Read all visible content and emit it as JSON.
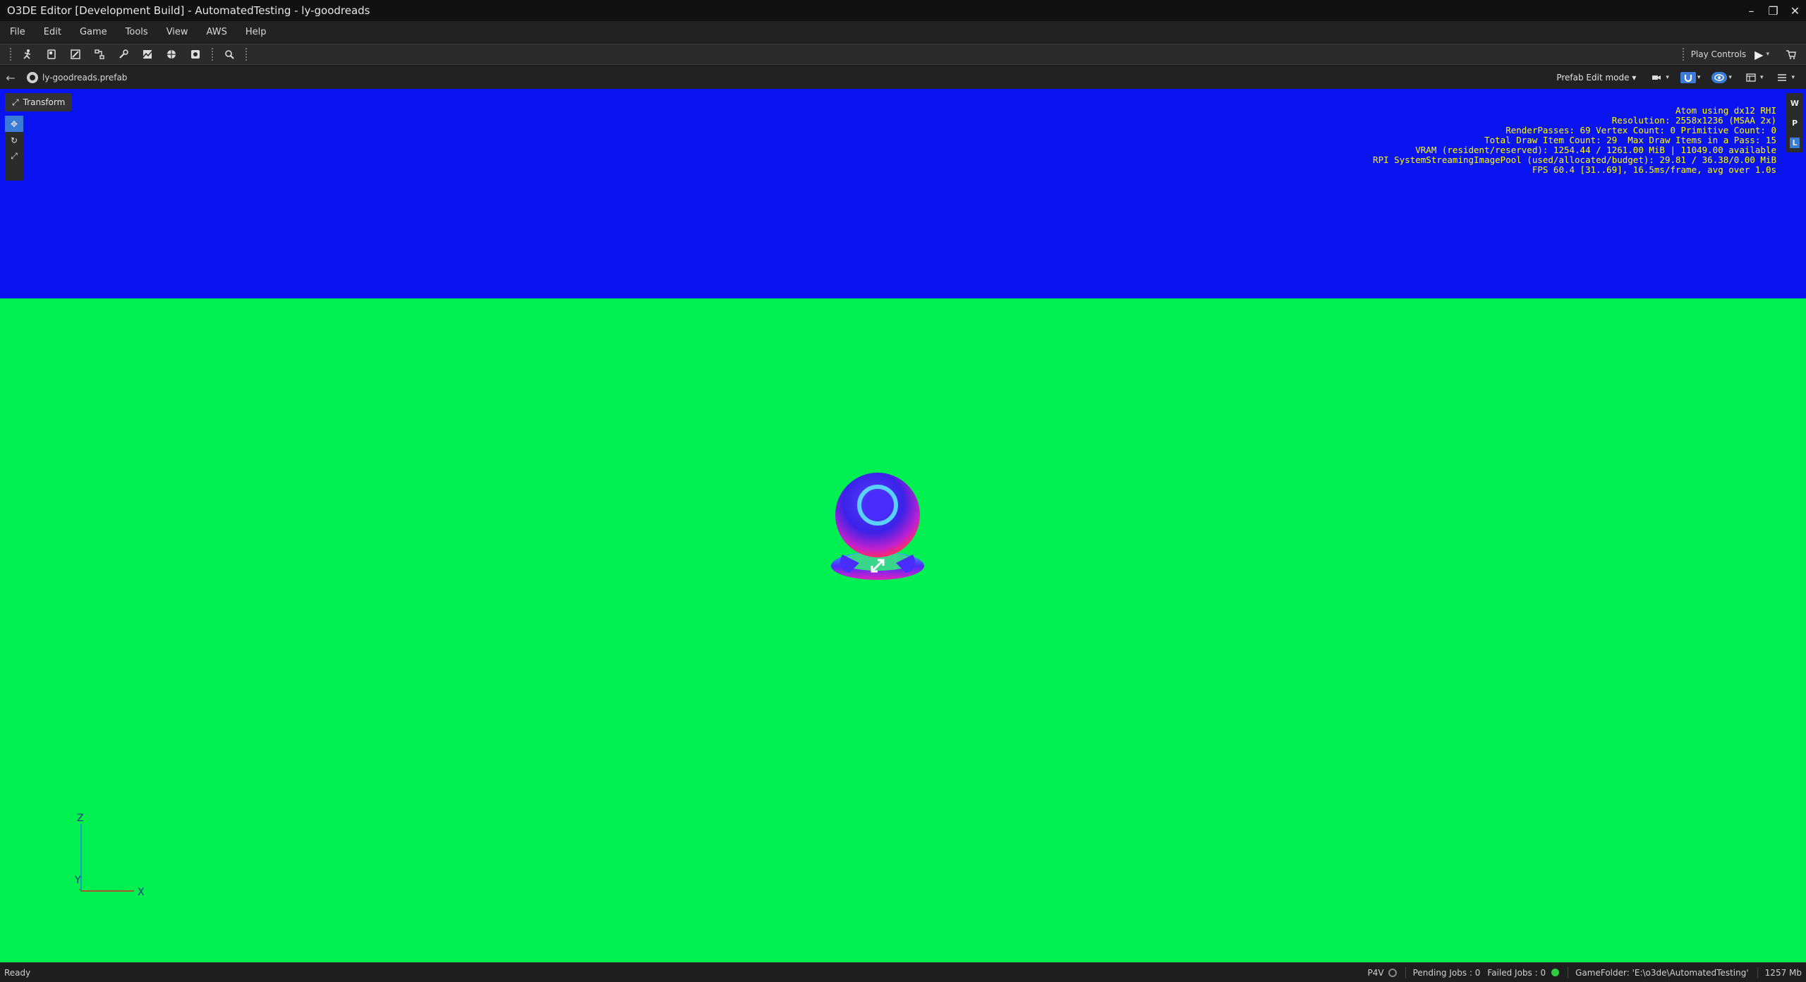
{
  "window": {
    "title": "O3DE Editor [Development Build] - AutomatedTesting - ly-goodreads",
    "minimize": "–",
    "restore": "❐",
    "close": "✕"
  },
  "menu": [
    {
      "label": "File"
    },
    {
      "label": "Edit"
    },
    {
      "label": "Game"
    },
    {
      "label": "Tools"
    },
    {
      "label": "View"
    },
    {
      "label": "AWS"
    },
    {
      "label": "Help"
    }
  ],
  "toolbar": {
    "play_controls_label": "Play Controls",
    "play_glyph": "▶",
    "caret": "▾"
  },
  "viewport_header": {
    "prefab_name": "ly-goodreads.prefab",
    "mode": "Prefab Edit mode ▾"
  },
  "viewport": {
    "transform_label": "Transform",
    "right_tools": [
      "W",
      "P",
      "L"
    ],
    "stats": [
      "Atom using dx12 RHI",
      "Resolution: 2558x1236 (MSAA 2x)",
      "RenderPasses: 69 Vertex Count: 0 Primitive Count: 0",
      "Total Draw Item Count: 29  Max Draw Items in a Pass: 15",
      "VRAM (resident/reserved): 1254.44 / 1261.00 MiB | 11049.00 available",
      "RPI SystemStreamingImagePool (used/allocated/budget): 29.81 / 36.38/0.00 MiB",
      "FPS 60.4 [31..69], 16.5ms/frame, avg over 1.0s"
    ],
    "axis_labels": {
      "z": "Z",
      "y": "Y",
      "x": "X"
    },
    "colors": {
      "sky": "#0a14f3",
      "ground": "#00f051",
      "stats": "#ffff00"
    }
  },
  "statusbar": {
    "ready": "Ready",
    "p4v": "P4V",
    "pending_jobs": "Pending Jobs : 0",
    "failed_jobs": "Failed Jobs : 0",
    "game_folder": "GameFolder: 'E:\\o3de\\AutomatedTesting'",
    "memory": "1257 Mb"
  }
}
